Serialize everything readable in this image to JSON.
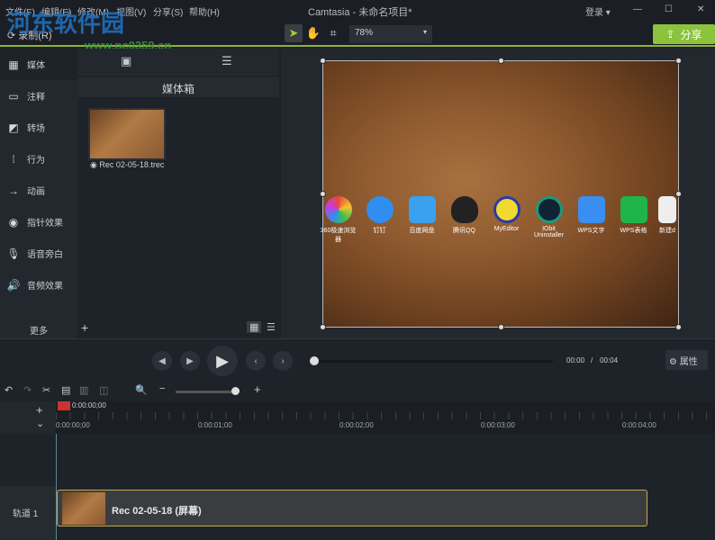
{
  "title_bar": {
    "menus": [
      "文件(F)",
      "编辑(E)",
      "修改(M)",
      "视图(V)",
      "分享(S)",
      "帮助(H)"
    ],
    "title": "Camtasia - 未命名项目*",
    "login": "登录 ▾",
    "minimize": "—",
    "maximize": "☐",
    "close": "✕"
  },
  "toolbar": {
    "record": "录制(R)",
    "zoom": "78%",
    "share": "分享"
  },
  "watermark": {
    "name": "河东软件园",
    "url": "www.pc0359.cn"
  },
  "tools": [
    {
      "label": "媒体",
      "icon": "film-icon"
    },
    {
      "label": "注释",
      "icon": "annotation-icon"
    },
    {
      "label": "转场",
      "icon": "transition-icon"
    },
    {
      "label": "行为",
      "icon": "behavior-icon"
    },
    {
      "label": "动画",
      "icon": "animation-icon"
    },
    {
      "label": "指针效果",
      "icon": "cursor-icon"
    },
    {
      "label": "语音旁白",
      "icon": "mic-icon"
    },
    {
      "label": "音频效果",
      "icon": "speaker-icon"
    }
  ],
  "more": "更多",
  "bin": {
    "title": "媒体箱",
    "item": "Rec 02-05-18.trec"
  },
  "desktop_icons": [
    {
      "label": "360极速浏览器",
      "color": "#e8493a"
    },
    {
      "label": "钉钉",
      "color": "#2f8ef0"
    },
    {
      "label": "百度网盘",
      "color": "#3aa0f0"
    },
    {
      "label": "腾讯QQ",
      "color": "#222222"
    },
    {
      "label": "MyEditor",
      "color": "#f1d930"
    },
    {
      "label": "IObit Uninstaller",
      "color": "#1a5a50"
    },
    {
      "label": "WPS文字",
      "color": "#3a8ef0"
    },
    {
      "label": "WPS表格",
      "color": "#1fb54a"
    },
    {
      "label": "新建d",
      "color": "#eeeeee"
    }
  ],
  "playback": {
    "time": "00:00",
    "sep": "/",
    "duration": "00:04",
    "properties": "属性",
    "progress": 0
  },
  "timeline": {
    "playhead": "0:00:00;00",
    "ticks": [
      "0:00:00;00",
      "0:00:01;00",
      "0:00:02;00",
      "0:00:03;00",
      "0:00:04;00"
    ],
    "track": "轨道 1",
    "clip": "Rec 02-05-18 (屏幕)",
    "zoom_level": 0.9
  }
}
